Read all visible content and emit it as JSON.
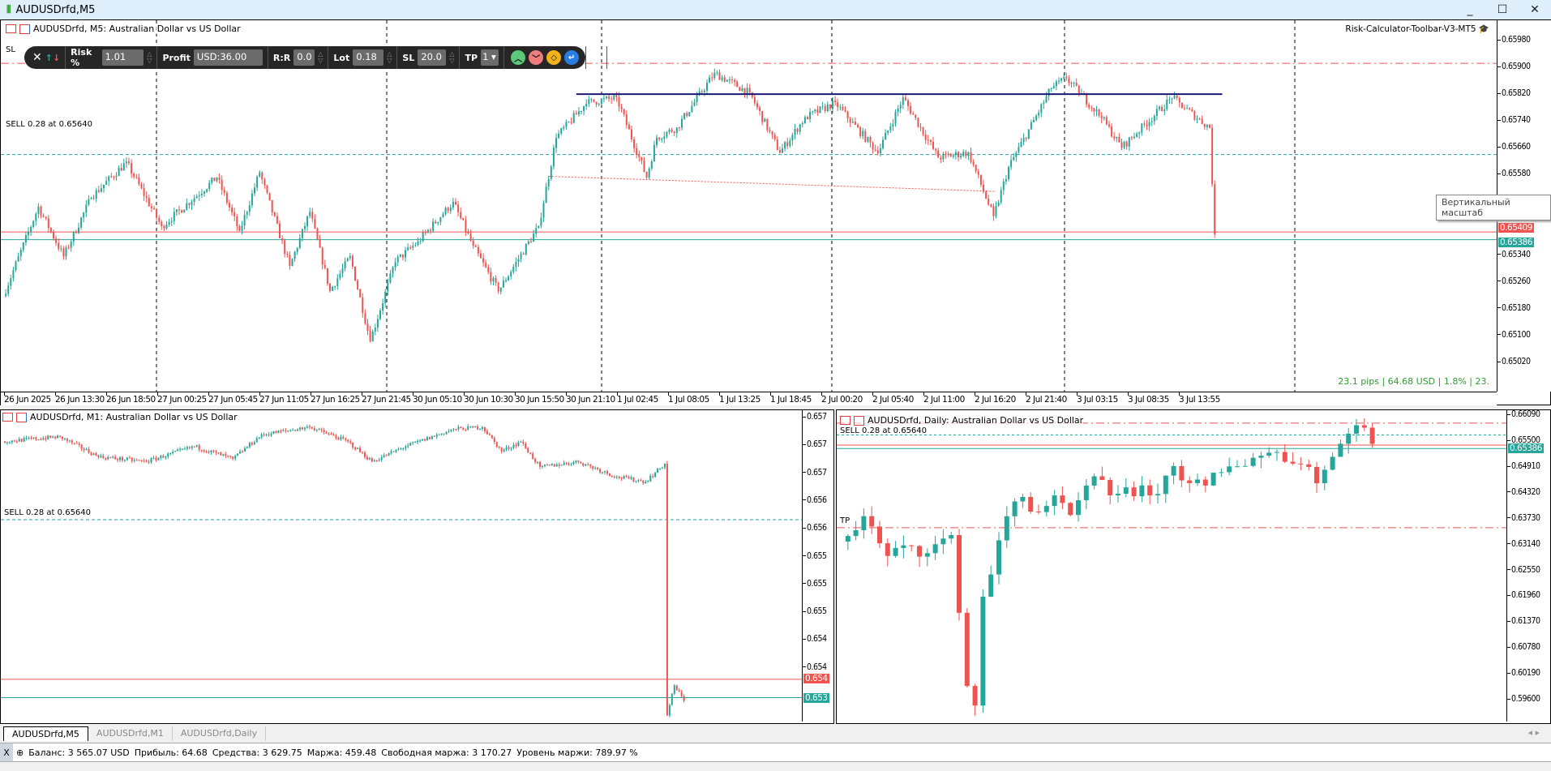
{
  "window": {
    "title": "AUDUSDrfd,M5",
    "minimize": "_",
    "maximize": "☐",
    "close": "✕"
  },
  "colors": {
    "bull": "#26a69a",
    "bear": "#ef5350",
    "bid": "#ef5350",
    "ask": "#26a69a",
    "level": "#1a1a7a",
    "sell": "#26a69a",
    "sltp": "#ef5350"
  },
  "m5": {
    "header": "AUDUSDrfd, M5:  Australian Dollar vs US Dollar",
    "ea_name": "Risk-Calculator-Toolbar-V3-MT5",
    "sl_label": "SL",
    "sell_label": "SELL 0.28 at 0.65640",
    "pips_info": "23.1 pips | 64.68 USD | 1.8% | 23.",
    "tooltip": "Вертикальный масштаб",
    "bid_tag": "0.65409",
    "ask_tag": "0.65386",
    "price_labels": [
      "0.65980",
      "0.65900",
      "0.65820",
      "0.65740",
      "0.65660",
      "0.65580",
      "0.65340",
      "0.65260",
      "0.65180",
      "0.65100",
      "0.65020"
    ],
    "date_labels": [
      "26 Jun 2025",
      "26 Jun 13:30",
      "26 Jun 18:50",
      "27 Jun 00:25",
      "27 Jun 05:45",
      "27 Jun 11:05",
      "27 Jun 16:25",
      "27 Jun 21:45",
      "30 Jun 05:10",
      "30 Jun 10:30",
      "30 Jun 15:50",
      "30 Jun 21:10",
      "1 Jul 02:45",
      "1 Jul 08:05",
      "1 Jul 13:25",
      "1 Jul 18:45",
      "2 Jul 00:20",
      "2 Jul 05:40",
      "2 Jul 11:00",
      "2 Jul 16:20",
      "2 Jul 21:40",
      "3 Jul 03:15",
      "3 Jul 08:35",
      "3 Jul 13:55"
    ],
    "levels": {
      "sl": 0.65912,
      "sell": 0.6564,
      "bid": 0.65409,
      "ask": 0.65386,
      "resistance": 0.6582
    },
    "path": [
      [
        0,
        0.65218
      ],
      [
        14,
        0.65484
      ],
      [
        24,
        0.65336
      ],
      [
        35,
        0.65513
      ],
      [
        49,
        0.65617
      ],
      [
        63,
        0.65425
      ],
      [
        85,
        0.65572
      ],
      [
        94,
        0.6541
      ],
      [
        102,
        0.65587
      ],
      [
        114,
        0.65306
      ],
      [
        122,
        0.65469
      ],
      [
        130,
        0.65233
      ],
      [
        138,
        0.65336
      ],
      [
        146,
        0.65085
      ],
      [
        156,
        0.65321
      ],
      [
        165,
        0.6538
      ],
      [
        179,
        0.65498
      ],
      [
        187,
        0.65366
      ],
      [
        197,
        0.65233
      ],
      [
        213,
        0.65425
      ],
      [
        220,
        0.65691
      ],
      [
        232,
        0.65794
      ],
      [
        244,
        0.65809
      ],
      [
        256,
        0.65572
      ],
      [
        260,
        0.65691
      ],
      [
        268,
        0.6572
      ],
      [
        283,
        0.65883
      ],
      [
        297,
        0.65823
      ],
      [
        309,
        0.65646
      ],
      [
        319,
        0.6575
      ],
      [
        331,
        0.65794
      ],
      [
        348,
        0.65646
      ],
      [
        358,
        0.65809
      ],
      [
        372,
        0.65631
      ],
      [
        384,
        0.65646
      ],
      [
        394,
        0.65454
      ],
      [
        400,
        0.65602
      ],
      [
        417,
        0.65838
      ],
      [
        423,
        0.65868
      ],
      [
        437,
        0.6575
      ],
      [
        445,
        0.65661
      ],
      [
        465,
        0.65809
      ],
      [
        480,
        0.6572
      ],
      [
        482,
        0.654
      ]
    ]
  },
  "toolbar": {
    "risk_label": "Risk %",
    "risk_value": "1.01",
    "profit_label": "Profit",
    "profit_value": "USD:36.00",
    "rr_label": "R:R",
    "rr_value": "0.0",
    "lot_label": "Lot",
    "lot_value": "0.18",
    "sl_label": "SL",
    "sl_value": "20.0",
    "tp_label": "TP",
    "tp_value": "1"
  },
  "m1": {
    "header": "AUDUSDrfd, M1:  Australian Dollar vs US Dollar",
    "sell_label": "SELL 0.28 at 0.65640",
    "price_labels": [
      "0.657",
      "0.657",
      "0.657",
      "0.656",
      "0.656",
      "0.655",
      "0.655",
      "0.655",
      "0.654",
      "0.654"
    ],
    "bid_tag": "0.654",
    "ask_tag": "0.653",
    "path": [
      [
        0,
        0.65753
      ],
      [
        24,
        0.6576
      ],
      [
        40,
        0.65731
      ],
      [
        60,
        0.65724
      ],
      [
        80,
        0.65746
      ],
      [
        96,
        0.65728
      ],
      [
        108,
        0.65763
      ],
      [
        128,
        0.65774
      ],
      [
        144,
        0.65753
      ],
      [
        154,
        0.65724
      ],
      [
        168,
        0.65746
      ],
      [
        188,
        0.65771
      ],
      [
        200,
        0.65774
      ],
      [
        208,
        0.65739
      ],
      [
        216,
        0.65753
      ],
      [
        224,
        0.65716
      ],
      [
        240,
        0.65724
      ],
      [
        256,
        0.65702
      ],
      [
        268,
        0.65695
      ],
      [
        276,
        0.65721
      ],
      [
        277,
        0.65357
      ],
      [
        280,
        0.654
      ],
      [
        284,
        0.65378
      ]
    ]
  },
  "daily": {
    "header": "AUDUSDrfd, Daily:  Australian Dollar vs US Dollar",
    "sell_label": "SELL 0.28 at 0.65640",
    "tp_label": "TP",
    "price_labels": [
      "0.66090",
      "0.65500",
      "0.64910",
      "0.64320",
      "0.63730",
      "0.63140",
      "0.62550",
      "0.61960",
      "0.61370",
      "0.60780",
      "0.60190",
      "0.59600"
    ],
    "ask_tag": "0.65386",
    "levels": {
      "tp": 0.63525
    },
    "path": [
      [
        0,
        0.63208
      ],
      [
        3,
        0.63775
      ],
      [
        6,
        0.62867
      ],
      [
        8,
        0.63094
      ],
      [
        11,
        0.62981
      ],
      [
        14,
        0.63321
      ],
      [
        15,
        0.61619
      ],
      [
        16,
        0.59916
      ],
      [
        17,
        0.59462
      ],
      [
        18,
        0.61959
      ],
      [
        20,
        0.63208
      ],
      [
        21,
        0.63775
      ],
      [
        23,
        0.64229
      ],
      [
        25,
        0.63889
      ],
      [
        27,
        0.64229
      ],
      [
        29,
        0.63775
      ],
      [
        32,
        0.64683
      ],
      [
        34,
        0.64229
      ],
      [
        36,
        0.64456
      ],
      [
        39,
        0.64229
      ],
      [
        42,
        0.6491
      ],
      [
        44,
        0.6457
      ],
      [
        46,
        0.64456
      ],
      [
        49,
        0.6491
      ],
      [
        52,
        0.65137
      ],
      [
        55,
        0.65251
      ],
      [
        57,
        0.65024
      ],
      [
        59,
        0.6491
      ],
      [
        60,
        0.6457
      ],
      [
        62,
        0.65137
      ],
      [
        64,
        0.65705
      ],
      [
        66,
        0.65818
      ],
      [
        67,
        0.65432
      ]
    ]
  },
  "tabs": [
    {
      "label": "AUDUSDrfd,M5"
    },
    {
      "label": "AUDUSDrfd,M1"
    },
    {
      "label": "AUDUSDrfd,Daily"
    }
  ],
  "status": {
    "close": "X",
    "balance": "Баланс: 3 565.07 USD",
    "profit": "Прибыль: 64.68",
    "equity": "Средства: 3 629.75",
    "margin": "Маржа: 459.48",
    "free_margin": "Свободная маржа: 3 170.27",
    "margin_level": "Уровень маржи: 789.97 %"
  }
}
